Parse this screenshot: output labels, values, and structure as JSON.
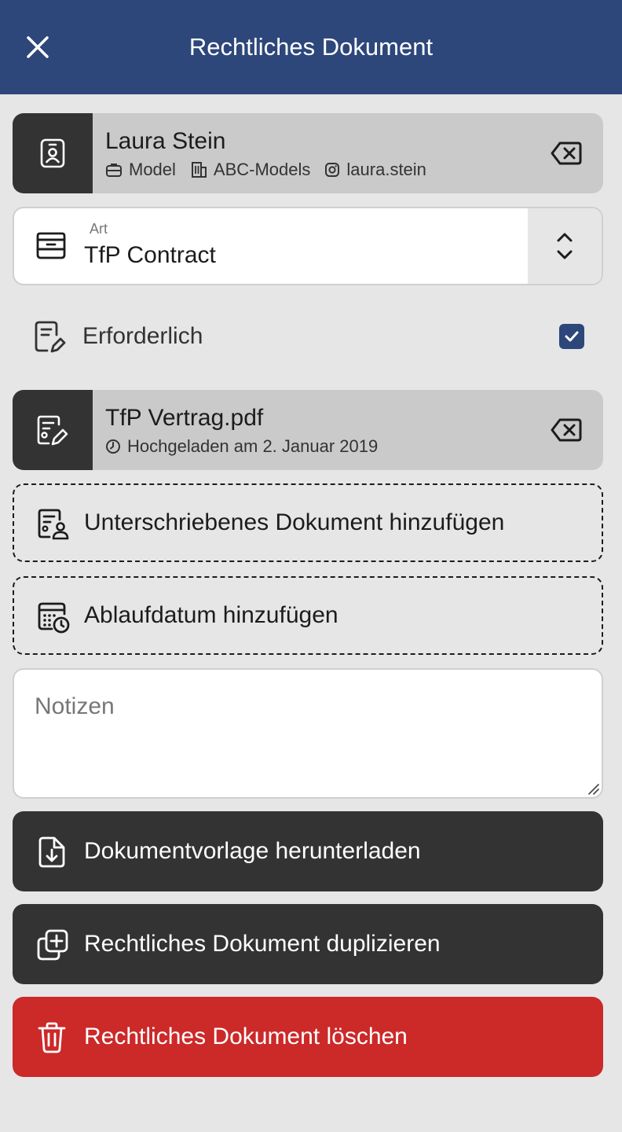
{
  "header": {
    "title": "Rechtliches Dokument",
    "close_icon": "close-icon"
  },
  "contact": {
    "icon": "contact-badge-icon",
    "name": "Laura Stein",
    "role": "Model",
    "agency": "ABC-Models",
    "instagram": "laura.stein",
    "remove_icon": "backspace-icon"
  },
  "type_select": {
    "label": "Art",
    "value": "TfP Contract",
    "icon": "archive-box-icon"
  },
  "required": {
    "label": "Erforderlich",
    "checked": true
  },
  "file": {
    "name": "TfP Vertrag.pdf",
    "uploaded": "Hochgeladen am 2. Januar 2019",
    "remove_icon": "backspace-icon"
  },
  "actions": {
    "add_signed": "Unterschriebenes Dokument hinzufügen",
    "add_expiry": "Ablaufdatum hinzufügen"
  },
  "notes": {
    "placeholder": "Notizen",
    "value": ""
  },
  "buttons": {
    "download": "Dokumentvorlage herunterladen",
    "duplicate": "Rechtliches Dokument duplizieren",
    "delete": "Rechtliches Dokument löschen"
  },
  "colors": {
    "header": "#2d477b",
    "dark_button": "#333333",
    "danger": "#cc2929",
    "background": "#e6e6e6",
    "checkbox": "#2d477b"
  }
}
